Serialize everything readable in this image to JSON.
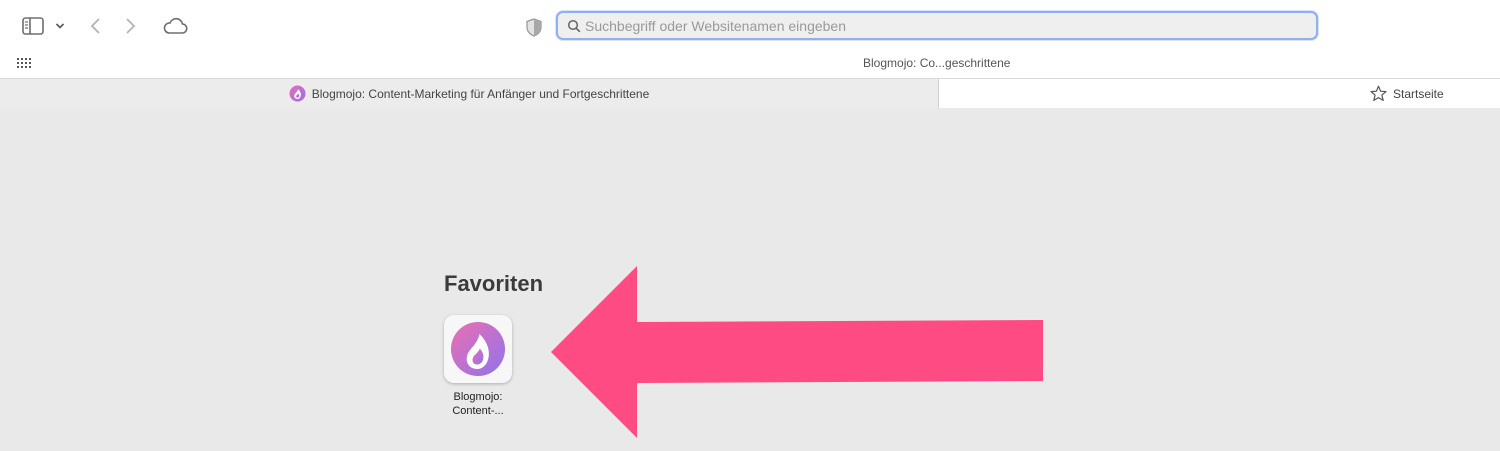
{
  "toolbar": {
    "sidebar_icon": "sidebar-icon",
    "sidebar_chevron_icon": "chevron-down-icon",
    "back_icon": "chevron-left-icon",
    "forward_icon": "chevron-right-icon",
    "cloud_icon": "cloud-icon",
    "privacy_icon": "shield-icon",
    "address_placeholder": "Suchbegriff oder Websitenamen eingeben",
    "address_value": "",
    "grid_icon": "grid-icon",
    "page_title_short": "Blogmojo: Co...geschrittene",
    "accent_color": "#8fb0f2"
  },
  "tabs": [
    {
      "label": "Blogmojo: Content-Marketing für Anfänger und Fortgeschrittene",
      "icon": "blogmojo-favicon-icon",
      "active": false
    },
    {
      "label": "Startseite",
      "icon": "star-icon",
      "active": true
    }
  ],
  "content": {
    "favorites_heading": "Favoriten",
    "favorites": [
      {
        "label_line1": "Blogmojo:",
        "label_line2": "Content-...",
        "icon": "blogmojo-logo-icon"
      }
    ],
    "annotation": {
      "type": "arrow-left",
      "color": "#ff4b84"
    }
  }
}
